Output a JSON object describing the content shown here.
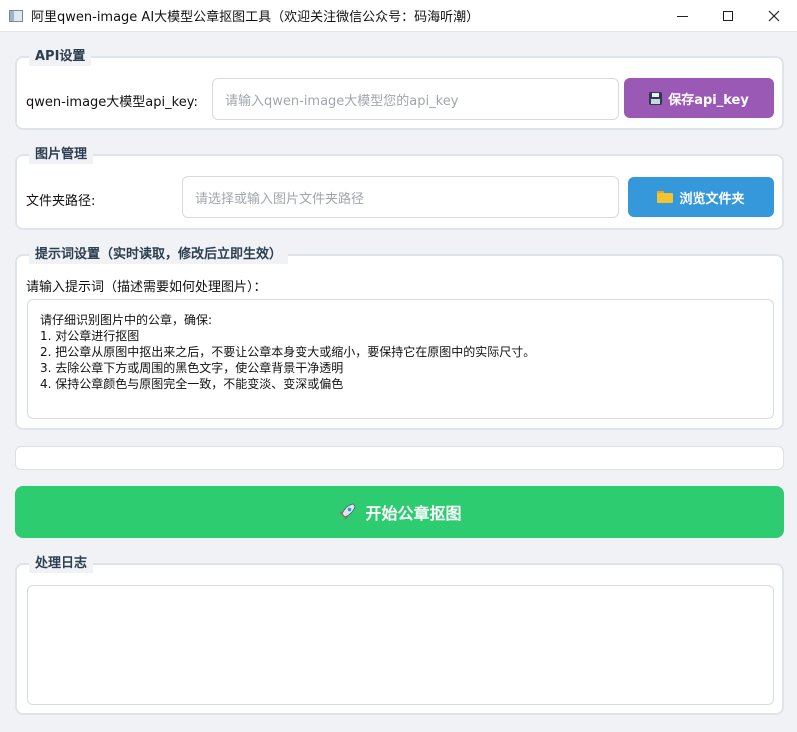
{
  "window": {
    "title": "阿里qwen-image AI大模型公章抠图工具（欢迎关注微信公众号：码海听潮）",
    "controls": {
      "minimize": "—",
      "maximize": "☐",
      "close": "✕"
    }
  },
  "api": {
    "legend": "API设置",
    "label": "qwen-image大模型api_key:",
    "input_placeholder": "请输入qwen-image大模型您的api_key",
    "input_value": "",
    "save_button": "保存api_key",
    "save_icon": "floppy-disk-icon",
    "save_color": "#9b59b6"
  },
  "images": {
    "legend": "图片管理",
    "label": "文件夹路径:",
    "input_placeholder": "请选择或输入图片文件夹路径",
    "input_value": "",
    "browse_button": "浏览文件夹",
    "browse_icon": "folder-icon",
    "browse_color": "#3498db"
  },
  "prompt": {
    "legend": "提示词设置（实时读取，修改后立即生效）",
    "label": "请输入提示词（描述需要如何处理图片）：",
    "lines": [
      "请仔细识别图片中的公章，确保:",
      "1. 对公章进行抠图",
      "2. 把公章从原图中抠出来之后，不要让公章本身变大或缩小，要保持它在原图中的实际尺寸。",
      "3. 去除公章下方或周围的黑色文字，使公章背景干净透明",
      "4. 保持公章颜色与原图完全一致，不能变淡、变深或偏色"
    ]
  },
  "progress": {
    "value": 0
  },
  "start": {
    "label": "开始公章抠图",
    "icon": "rocket-icon",
    "color": "#2ecc71"
  },
  "log": {
    "legend": "处理日志",
    "content": ""
  }
}
